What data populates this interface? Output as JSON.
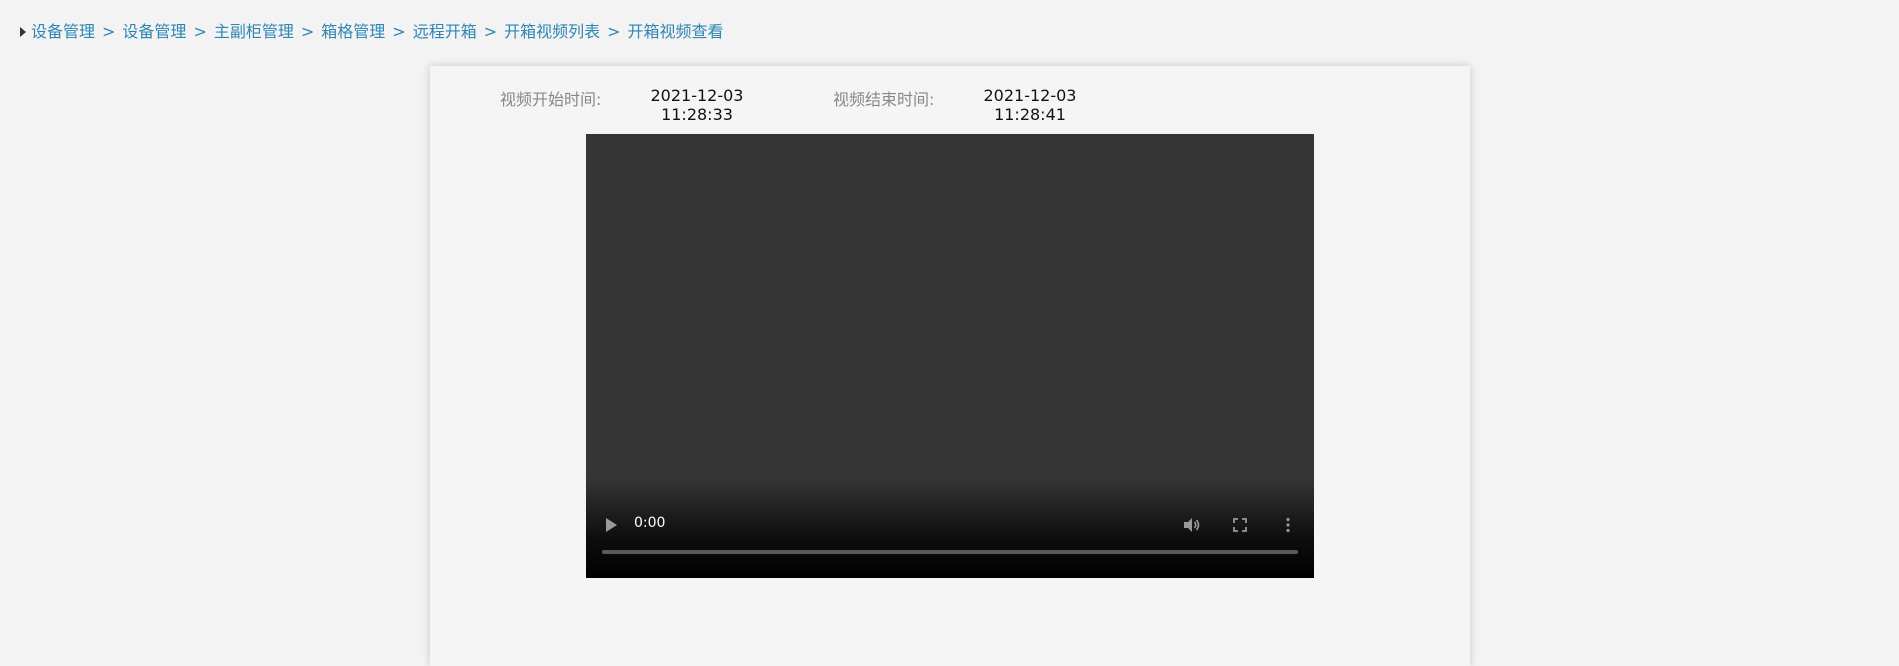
{
  "breadcrumb": [
    "设备管理",
    "设备管理",
    "主副柜管理",
    "箱格管理",
    "远程开箱",
    "开箱视频列表",
    "开箱视频查看"
  ],
  "breadcrumb_separator": ">",
  "video_info": {
    "start_label": "视频开始时间:",
    "start_date": "2021-12-03",
    "start_time": "11:28:33",
    "end_label": "视频结束时间:",
    "end_date": "2021-12-03",
    "end_time": "11:28:41"
  },
  "player": {
    "current_time": "0:00",
    "progress": 0,
    "icons": [
      "play-icon",
      "volume-icon",
      "fullscreen-icon",
      "more-options-icon"
    ]
  },
  "colors": {
    "link": "#2e86b3",
    "video_bg": "#353535",
    "page_bg": "#f3f3f3"
  }
}
